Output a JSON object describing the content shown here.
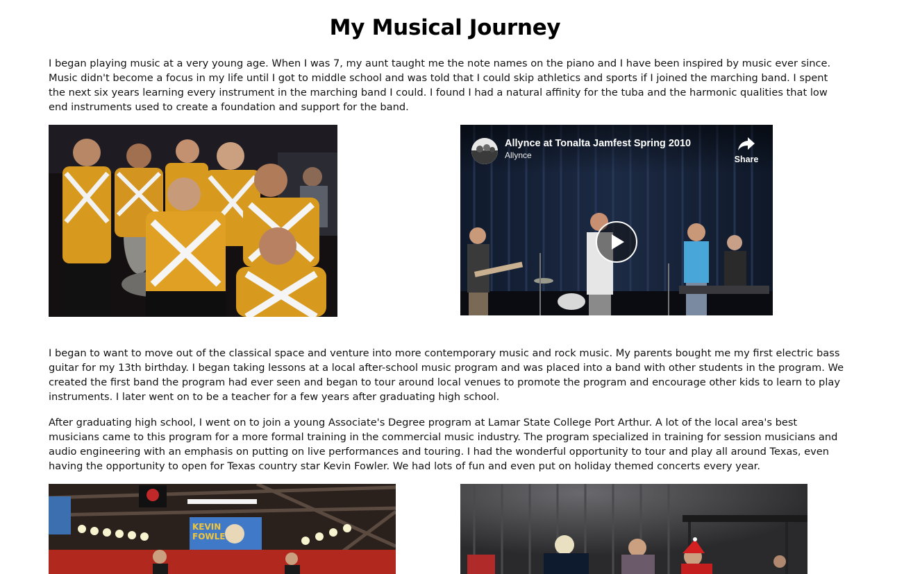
{
  "page": {
    "title": "My Musical Journey"
  },
  "paragraphs": [
    "I began playing music at a very young age. When I was 7, my aunt taught me the note names on the piano and I have been inspired by music ever since. Music didn't become a focus in my life until I got to middle school and was told that I could skip athletics and sports if I joined the marching band. I spent the next six years learning every instrument in the marching band I could. I found I had a natural affinity for the tuba and the harmonic qualities that low end instruments used to create a foundation and support for the band.",
    "I began to want to move out of the classical space and venture into more contemporary music and rock music. My parents bought me my first electric bass guitar for my 13th birthday. I began taking lessons at a local after-school music program and was placed into a band with other students in the program. We created the first band the program had ever seen and began to tour around local venues to promote the program and encourage other kids to learn to play instruments. I later went on to be a teacher for a few years after graduating high school.",
    "After graduating high school, I went on to join a young Associate's Degree program at Lamar State College Port Arthur. A lot of the local area's best musicians came to this program for a more formal training in the commercial music industry. The program specialized in training for session musicians and audio engineering with an emphasis on putting on live performances and touring. I had the wonderful opportunity to tour and play all around Texas, even having the opportunity to open for Texas country star Kevin Fowler. We had lots of fun and even put on holiday themed concerts every year."
  ],
  "video": {
    "title": "Allynce at Tonalta Jamfest Spring 2010",
    "channel": "Allynce",
    "share_label": "Share"
  },
  "stage_banner": {
    "line1": "KEVIN",
    "line2": "FOWLER"
  },
  "colors": {
    "band_gold": "#d89a1e",
    "stage_curtain": "#1c2a44",
    "text": "#111111"
  }
}
